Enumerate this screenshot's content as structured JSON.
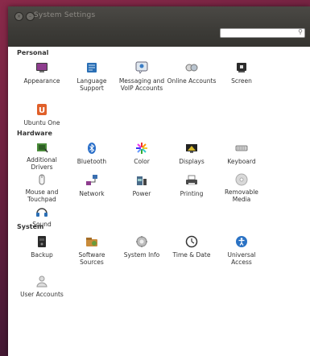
{
  "window": {
    "title": "System Settings",
    "search_placeholder": ""
  },
  "sections": [
    {
      "title": "Personal",
      "items": [
        {
          "label": "Appearance",
          "icon": "appearance-icon"
        },
        {
          "label": "Language Support",
          "icon": "language-icon"
        },
        {
          "label": "Messaging and VoIP Accounts",
          "icon": "messaging-icon"
        },
        {
          "label": "Online Accounts",
          "icon": "online-accounts-icon"
        },
        {
          "label": "Screen",
          "icon": "screen-icon"
        },
        {
          "label": "Ubuntu One",
          "icon": "ubuntu-one-icon"
        }
      ]
    },
    {
      "title": "Hardware",
      "items": [
        {
          "label": "Additional Drivers",
          "icon": "drivers-icon"
        },
        {
          "label": "Bluetooth",
          "icon": "bluetooth-icon"
        },
        {
          "label": "Color",
          "icon": "color-icon"
        },
        {
          "label": "Displays",
          "icon": "displays-icon"
        },
        {
          "label": "Keyboard",
          "icon": "keyboard-icon"
        },
        {
          "label": "Mouse and Touchpad",
          "icon": "mouse-icon"
        },
        {
          "label": "Network",
          "icon": "network-icon"
        },
        {
          "label": "Power",
          "icon": "power-icon"
        },
        {
          "label": "Printing",
          "icon": "printer-icon"
        },
        {
          "label": "Removable Media",
          "icon": "removable-media-icon"
        },
        {
          "label": "Sound",
          "icon": "sound-icon"
        }
      ]
    },
    {
      "title": "System",
      "items": [
        {
          "label": "Backup",
          "icon": "backup-icon"
        },
        {
          "label": "Software Sources",
          "icon": "software-sources-icon"
        },
        {
          "label": "System Info",
          "icon": "system-info-icon"
        },
        {
          "label": "Time & Date",
          "icon": "clock-icon"
        },
        {
          "label": "Universal Access",
          "icon": "universal-access-icon"
        },
        {
          "label": "User Accounts",
          "icon": "user-accounts-icon"
        }
      ]
    }
  ]
}
